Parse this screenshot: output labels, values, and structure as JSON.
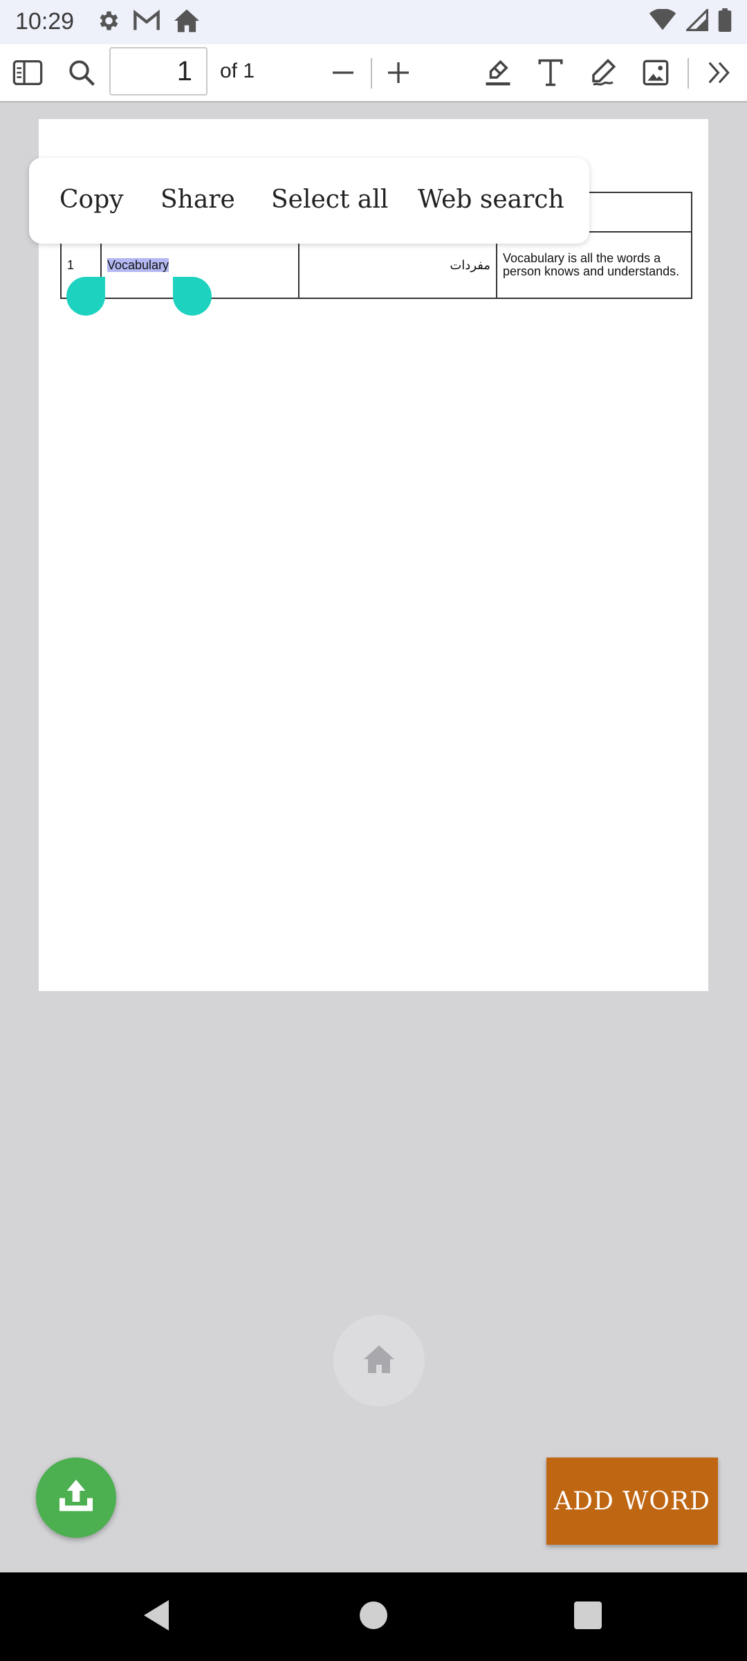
{
  "status_bar": {
    "time": "10:29",
    "left_icons": [
      "gear-icon",
      "gmail-icon",
      "home-icon"
    ],
    "right_icons": [
      "wifi-icon",
      "signal-icon",
      "battery-icon"
    ]
  },
  "toolbar": {
    "page_number": "1",
    "page_of": "of 1",
    "icons": [
      "sidebar-icon",
      "search-icon",
      "zoom-out-icon",
      "zoom-in-icon",
      "highlighter-icon",
      "text-icon",
      "pen-icon",
      "image-icon",
      "more-icon"
    ]
  },
  "context_menu": {
    "copy": "Copy",
    "share": "Share",
    "select_all": "Select all",
    "web_search": "Web search"
  },
  "table": {
    "rows": [
      {
        "num": "1",
        "word": "Vocabulary",
        "translation": "مفردات",
        "definition": "Vocabulary is all the words a person knows and understands."
      }
    ]
  },
  "buttons": {
    "add_word": "ADD WORD"
  },
  "colors": {
    "selection_handle": "#1ed2c0",
    "upload_fab": "#4caf50",
    "add_word_bg": "#bf6612",
    "selection_highlight": "#b3b8f2"
  }
}
